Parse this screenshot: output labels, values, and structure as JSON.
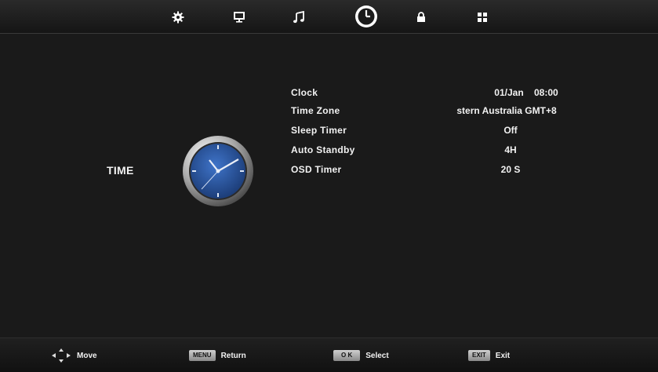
{
  "tabs": [
    {
      "icon": "gear-icon"
    },
    {
      "icon": "monitor-icon"
    },
    {
      "icon": "music-note-icon"
    },
    {
      "icon": "clock-icon",
      "selected": true
    },
    {
      "icon": "lock-icon"
    },
    {
      "icon": "apps-grid-icon"
    }
  ],
  "section": {
    "title": "TIME",
    "illustration": "clock-face-icon"
  },
  "menu": {
    "items": [
      {
        "label": "Clock",
        "value": "01/Jan 08:00"
      },
      {
        "label": "Time Zone",
        "value": "stern Australia GMT+8"
      },
      {
        "label": "Sleep Timer",
        "value": "Off"
      },
      {
        "label": "Auto Standby",
        "value": "4H"
      },
      {
        "label": "OSD Timer",
        "value": "20 S"
      }
    ]
  },
  "footer": {
    "move": {
      "icon": "dpad-arrows-icon",
      "label": "Move"
    },
    "return": {
      "key": "MENU",
      "label": "Return"
    },
    "select": {
      "key": "O K",
      "label": "Select"
    },
    "exit": {
      "key": "EXIT",
      "label": "Exit"
    }
  },
  "colors": {
    "background": "#1a1a1a",
    "text": "#f2f2f2",
    "clock_face": "#2b5aa8"
  }
}
